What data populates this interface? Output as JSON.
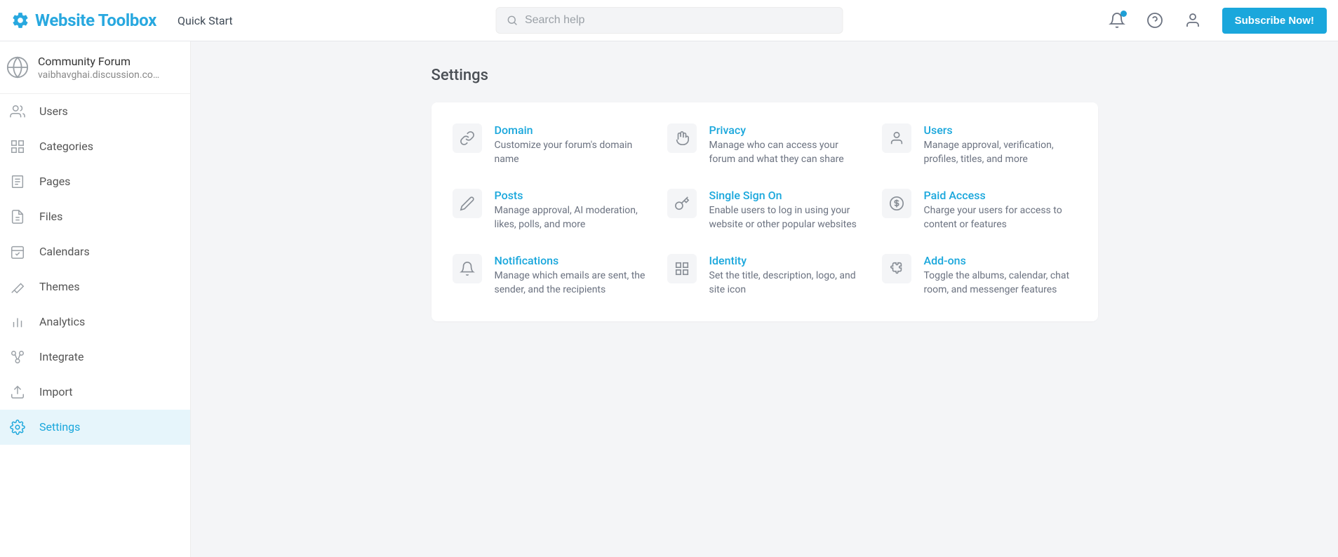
{
  "header": {
    "brand": "Website Toolbox",
    "quickStart": "Quick Start",
    "searchPlaceholder": "Search help",
    "subscribe": "Subscribe Now!"
  },
  "sidebar": {
    "forumName": "Community Forum",
    "forumUrl": "vaibhavghai.discussion.co…",
    "items": {
      "users": "Users",
      "categories": "Categories",
      "pages": "Pages",
      "files": "Files",
      "calendars": "Calendars",
      "themes": "Themes",
      "analytics": "Analytics",
      "integrate": "Integrate",
      "import": "Import",
      "settings": "Settings"
    }
  },
  "page": {
    "title": "Settings"
  },
  "cards": {
    "domain": {
      "title": "Domain",
      "desc": "Customize your forum's domain name"
    },
    "privacy": {
      "title": "Privacy",
      "desc": "Manage who can access your forum and what they can share"
    },
    "users": {
      "title": "Users",
      "desc": "Manage approval, verification, profiles, titles, and more"
    },
    "posts": {
      "title": "Posts",
      "desc": "Manage approval, AI moderation, likes, polls, and more"
    },
    "sso": {
      "title": "Single Sign On",
      "desc": "Enable users to log in using your website or other popular websites"
    },
    "paid": {
      "title": "Paid Access",
      "desc": "Charge your users for access to content or features"
    },
    "notifications": {
      "title": "Notifications",
      "desc": "Manage which emails are sent, the sender, and the recipients"
    },
    "identity": {
      "title": "Identity",
      "desc": "Set the title, description, logo, and site icon"
    },
    "addons": {
      "title": "Add-ons",
      "desc": "Toggle the albums, calendar, chat room, and messenger features"
    }
  }
}
